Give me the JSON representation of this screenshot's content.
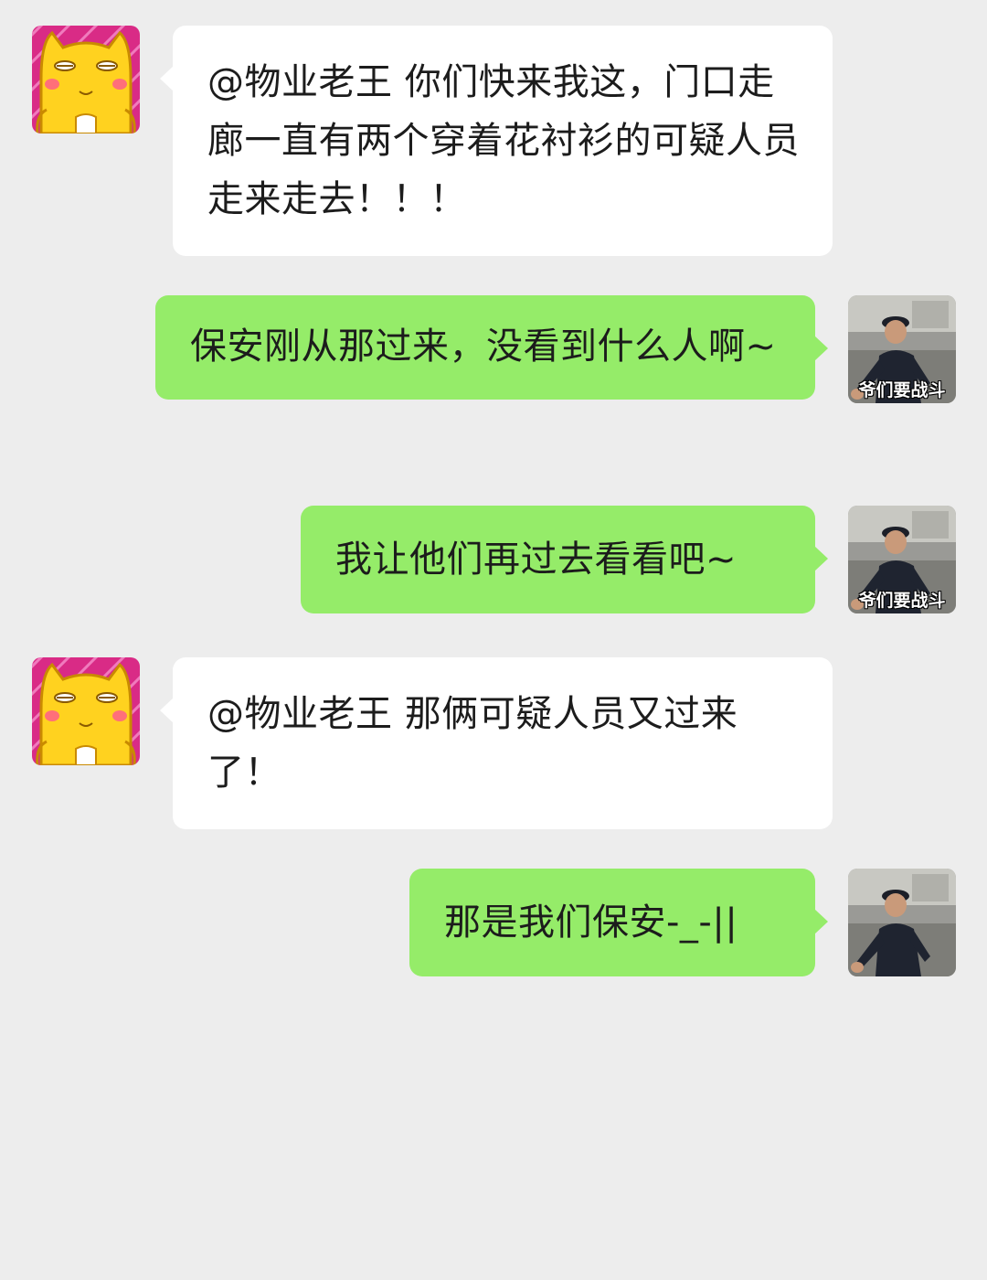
{
  "chat": {
    "messages": [
      {
        "side": "in",
        "avatar": "cat-avatar-icon",
        "text": "@物业老王 你们快来我这，门口走廊一直有两个穿着花衬衫的可疑人员走来走去！！！"
      },
      {
        "side": "out",
        "avatar": "security-guard-avatar",
        "avatar_caption": "爷们要战斗",
        "text": "保安刚从那过来，没看到什么人啊~"
      },
      {
        "side": "out",
        "avatar": "security-guard-avatar",
        "avatar_caption": "爷们要战斗",
        "text": "我让他们再过去看看吧~"
      },
      {
        "side": "in",
        "avatar": "cat-avatar-icon",
        "text": "@物业老王 那俩可疑人员又过来了！"
      },
      {
        "side": "out",
        "avatar": "security-guard-avatar",
        "avatar_caption": "",
        "text": "那是我们保安-_-||"
      }
    ]
  },
  "colors": {
    "background": "#ededed",
    "incoming_bubble": "#ffffff",
    "outgoing_bubble": "#95ec69",
    "text": "#1c1c1c"
  }
}
